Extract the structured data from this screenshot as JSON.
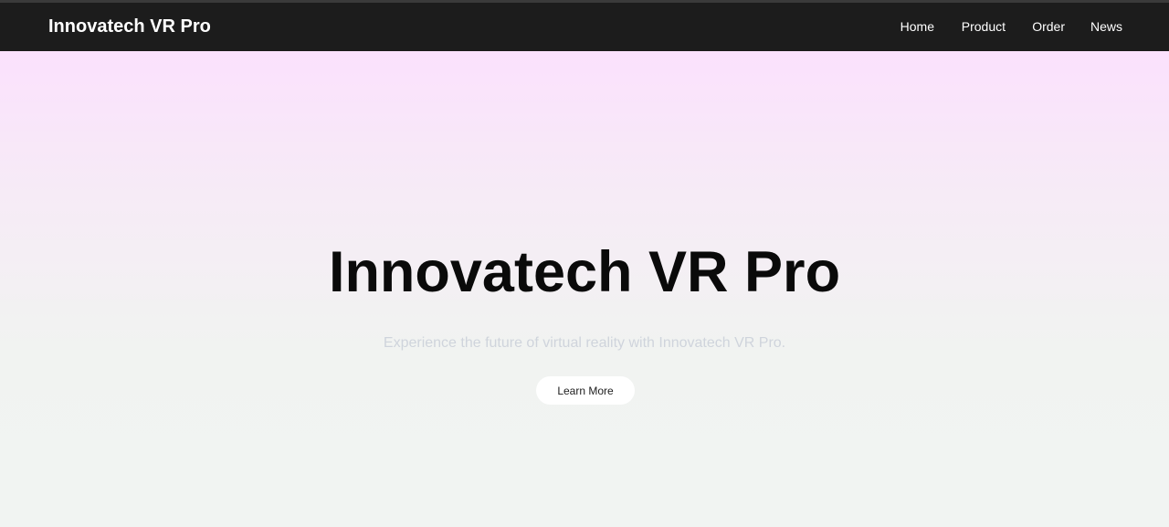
{
  "nav": {
    "brand": "Innovatech VR Pro",
    "links": [
      {
        "label": "Home"
      },
      {
        "label": "Product"
      },
      {
        "label": "Order"
      },
      {
        "label": "News"
      }
    ]
  },
  "hero": {
    "title": "Innovatech VR Pro",
    "subtitle": "Experience the future of virtual reality with Innovatech VR Pro.",
    "button_label": "Learn More"
  },
  "colors": {
    "navbar_background": "#1c1c1c",
    "hero_gradient_top": "#fbe1fd",
    "hero_gradient_bottom": "#f1f4f2",
    "title_text": "#0a0a0a",
    "subtitle_text": "#cfd4dc",
    "button_background": "#ffffff"
  }
}
